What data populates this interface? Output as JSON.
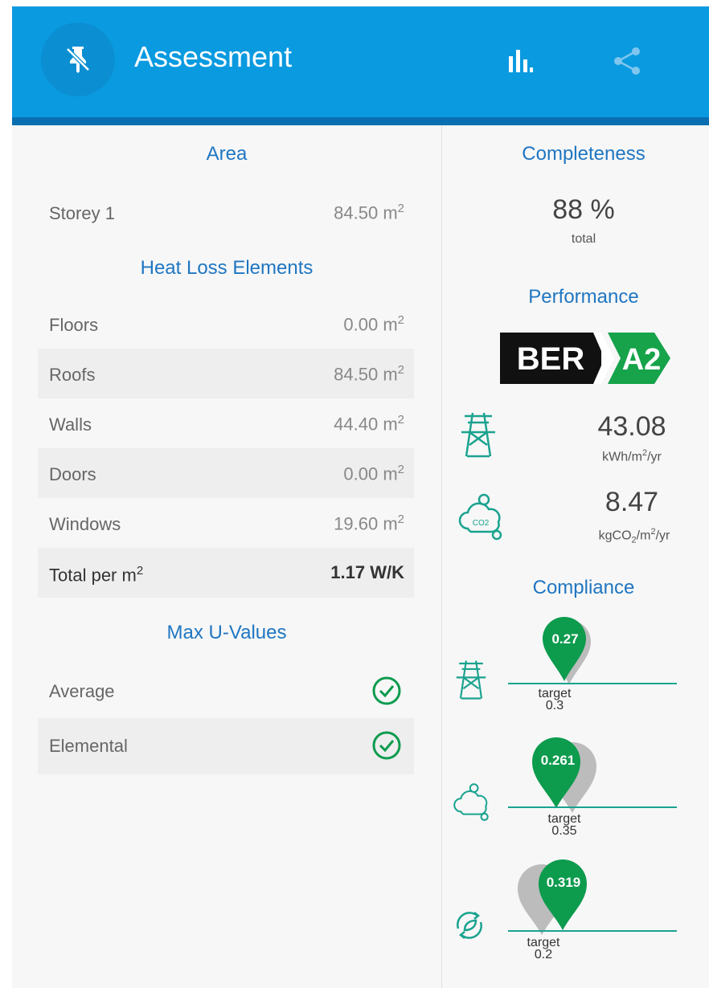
{
  "header": {
    "title": "Assessment",
    "colors": {
      "bar": "#0a9ae0",
      "strip": "#0a6fb0"
    }
  },
  "area": {
    "heading": "Area",
    "rows": [
      {
        "label": "Storey 1",
        "value": "84.50 m",
        "unit_sup": "2"
      }
    ]
  },
  "heat_loss": {
    "heading": "Heat Loss Elements",
    "rows": [
      {
        "label": "Floors",
        "value": "0.00 m",
        "unit_sup": "2"
      },
      {
        "label": "Roofs",
        "value": "84.50 m",
        "unit_sup": "2"
      },
      {
        "label": "Walls",
        "value": "44.40 m",
        "unit_sup": "2"
      },
      {
        "label": "Doors",
        "value": "0.00 m",
        "unit_sup": "2"
      },
      {
        "label": "Windows",
        "value": "19.60 m",
        "unit_sup": "2"
      }
    ],
    "total": {
      "label": "Total per m",
      "label_sup": "2",
      "value": "1.17 W/K"
    }
  },
  "max_u": {
    "heading": "Max U-Values",
    "rows": [
      {
        "label": "Average",
        "status_icon": "check-circle-icon"
      },
      {
        "label": "Elemental",
        "status_icon": "check-circle-icon"
      }
    ]
  },
  "completeness": {
    "heading": "Completeness",
    "value": "88 %",
    "sub": "total"
  },
  "performance": {
    "heading": "Performance",
    "ber_label": "BER",
    "ber_rating": "A2",
    "energy": {
      "value": "43.08",
      "unit_pre": "kWh/m",
      "unit_sup": "2",
      "unit_post": "/yr",
      "icon": "power-pylon-icon"
    },
    "co2": {
      "value": "8.47",
      "unit_pre": "kgCO",
      "unit_sub": "2",
      "unit_mid": "/m",
      "unit_sup": "2",
      "unit_post": "/yr",
      "icon": "co2-cloud-icon"
    }
  },
  "compliance": {
    "heading": "Compliance",
    "target_word": "target",
    "items": [
      {
        "value": "0.27",
        "target": "0.3",
        "icon": "power-pylon-icon"
      },
      {
        "value": "0.261",
        "target": "0.35",
        "icon": "co2-cloud-icon"
      },
      {
        "value": "0.319",
        "target": "0.2",
        "icon": "renewable-leaf-icon"
      }
    ]
  },
  "colors": {
    "accent": "#1f76c2",
    "pass_green": "#0d9b4e",
    "teal": "#1aa38f",
    "ber_green": "#16a34a"
  }
}
